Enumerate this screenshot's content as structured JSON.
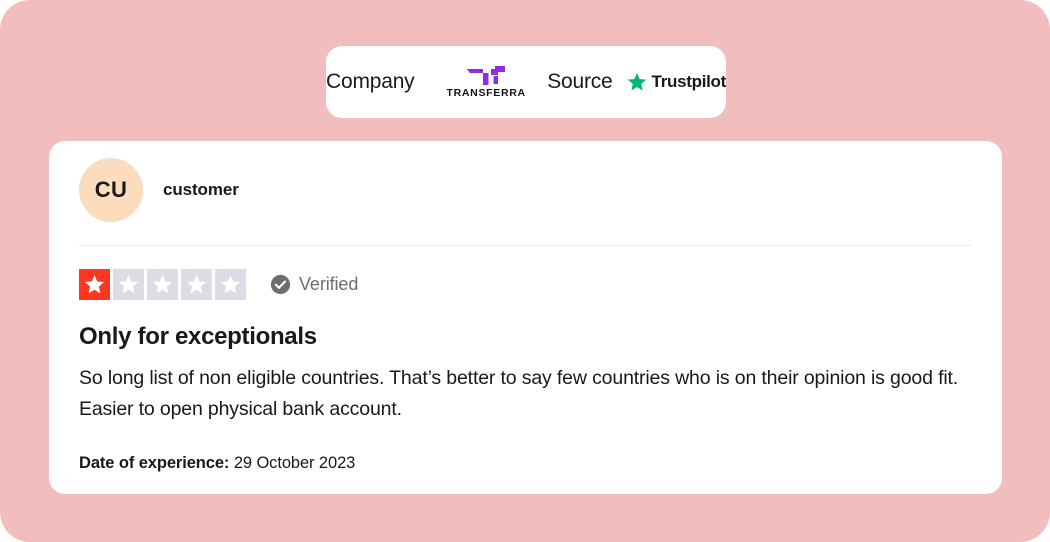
{
  "colors": {
    "background": "#F1BDBD",
    "card": "#FFFFFF",
    "star_active": "#FF3722",
    "star_inactive": "#DCDCE6",
    "trustpilot_green": "#00B67A",
    "transferra_purple": "#8B2FE0",
    "avatar_background": "#FBDCBD",
    "verified_gray": "#6E6E6E",
    "divider": "#EDEDED"
  },
  "source_bar": {
    "company_label": "Company",
    "company_logo": {
      "icon": "transferra-arrow-mark",
      "wordmark": "TRANSFERRA"
    },
    "source_label": "Source",
    "source_logo": {
      "icon": "trustpilot-star-icon",
      "wordmark": "Trustpilot"
    }
  },
  "review": {
    "avatar_initials": "CU",
    "reviewer_name": "customer",
    "rating": {
      "value": 1,
      "max": 5,
      "stars": [
        "on",
        "off",
        "off",
        "off",
        "off"
      ]
    },
    "verified": {
      "icon": "check-circle-icon",
      "label": "Verified"
    },
    "title": "Only for exceptionals",
    "body": "So long list of non eligible countries. That’s better to say few countries who is on their opinion is good fit. Easier to open physical bank account.",
    "date": {
      "label": "Date of experience:",
      "value": "29 October 2023"
    }
  }
}
